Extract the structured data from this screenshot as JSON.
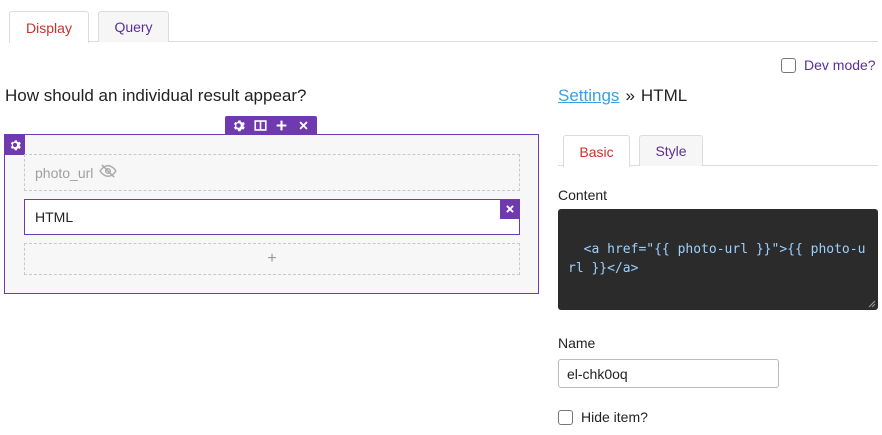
{
  "tabs": [
    {
      "label": "Display",
      "active": true
    },
    {
      "label": "Query",
      "active": false
    }
  ],
  "dev_mode": {
    "label": "Dev mode?",
    "checked": false
  },
  "left": {
    "title": "How should an individual result appear?",
    "fields": {
      "photo": "photo_url",
      "html": "HTML",
      "add": "+"
    }
  },
  "right": {
    "breadcrumb": {
      "link": "Settings",
      "separator": "»",
      "current": "HTML"
    },
    "tabs": [
      {
        "label": "Basic",
        "active": true
      },
      {
        "label": "Style",
        "active": false
      }
    ],
    "content_label": "Content",
    "content_value": "<a href=\"{{ photo-url }}\">{{ photo-url }}</a>",
    "name_label": "Name",
    "name_value": "el-chk0oq",
    "hide_label": "Hide item?",
    "hide_checked": false
  },
  "colors": {
    "accent": "#6f3ab0",
    "active_tab_text": "#c9302c",
    "link": "#3aa0e0",
    "code_bg": "#2b2b2b",
    "code_text": "#9cd1ff"
  },
  "icons": [
    "gear-icon",
    "columns-icon",
    "plus-icon",
    "close-icon",
    "eye-slash-icon",
    "resize-grip-icon"
  ]
}
